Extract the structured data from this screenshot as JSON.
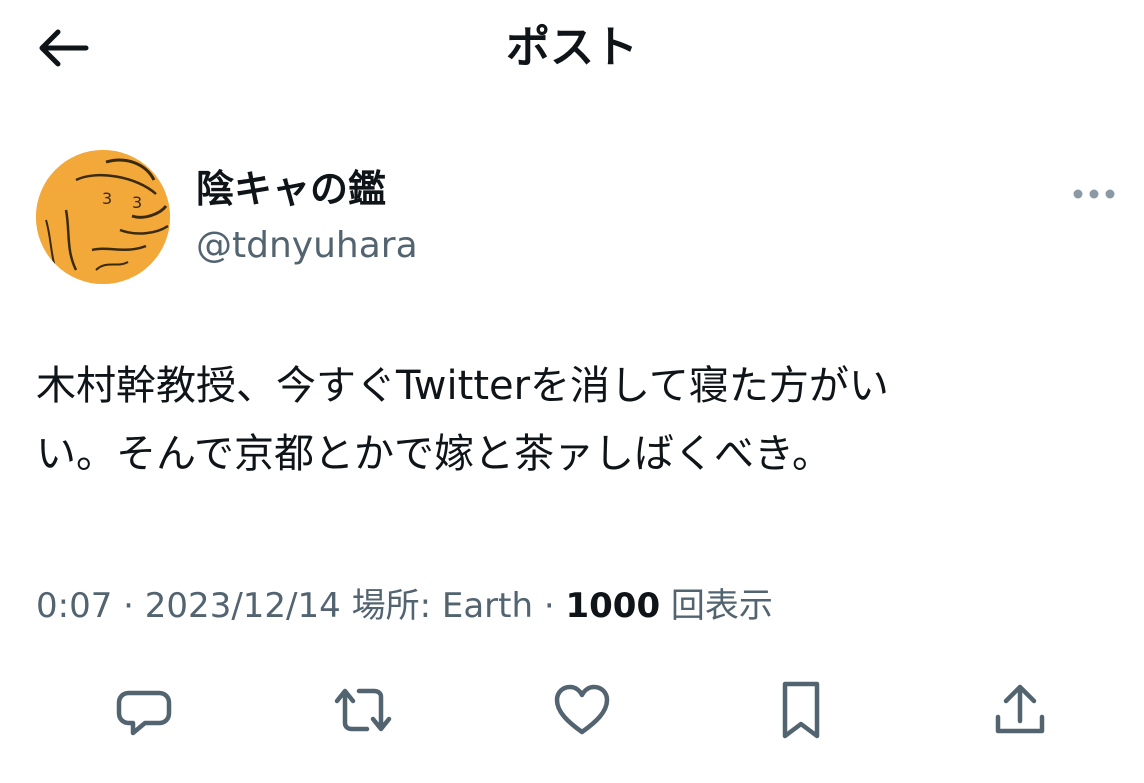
{
  "header": {
    "title": "ポスト",
    "back_icon": "arrow-left-icon"
  },
  "author": {
    "display_name": "陰キャの鑑",
    "handle": "@tdnyuhara",
    "avatar_color": "#f3a83a"
  },
  "tweet": {
    "text_lines": [
      "木村幹教授、今すぐTwitterを消して寝た方がい",
      "い。そんで京都とかで嫁と茶ァしばくべき。"
    ],
    "time": "0:07",
    "date": "2023/12/14",
    "location_label": "場所: Earth",
    "separator": "·",
    "views_count": "1000",
    "views_label": "回表示"
  },
  "actions": [
    {
      "name": "reply",
      "icon": "reply-icon"
    },
    {
      "name": "repost",
      "icon": "repost-icon"
    },
    {
      "name": "like",
      "icon": "heart-icon"
    },
    {
      "name": "bookmark",
      "icon": "bookmark-icon"
    },
    {
      "name": "share",
      "icon": "share-icon"
    }
  ],
  "colors": {
    "text_primary": "#0f1419",
    "text_secondary": "#536471",
    "icon_gray": "#536471"
  }
}
